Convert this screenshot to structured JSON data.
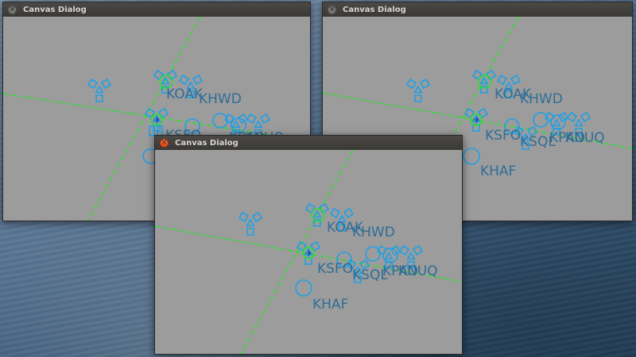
{
  "windows": [
    {
      "title": "Canvas Dialog",
      "close_icon": "close-icon",
      "active": false
    },
    {
      "title": "Canvas Dialog",
      "close_icon": "close-icon",
      "active": false
    },
    {
      "title": "Canvas Dialog",
      "close_icon": "close-icon",
      "active": true
    }
  ],
  "airports": {
    "koak": "KOAK",
    "khwd": "KHWD",
    "ksfo": "KSFO",
    "ksql": "KSQL",
    "kpao": "KPAO",
    "knuq": "KNUQ",
    "khaf": "KHAF"
  },
  "icons": {
    "vor": "vor-icon",
    "airport": "airport-circle-icon",
    "aircraft": "aircraft-icon"
  },
  "colors": {
    "navaid": "#1fa0e6",
    "route": "#27e327",
    "label": "#2f6d97",
    "canvas": "#9c9c9c"
  }
}
